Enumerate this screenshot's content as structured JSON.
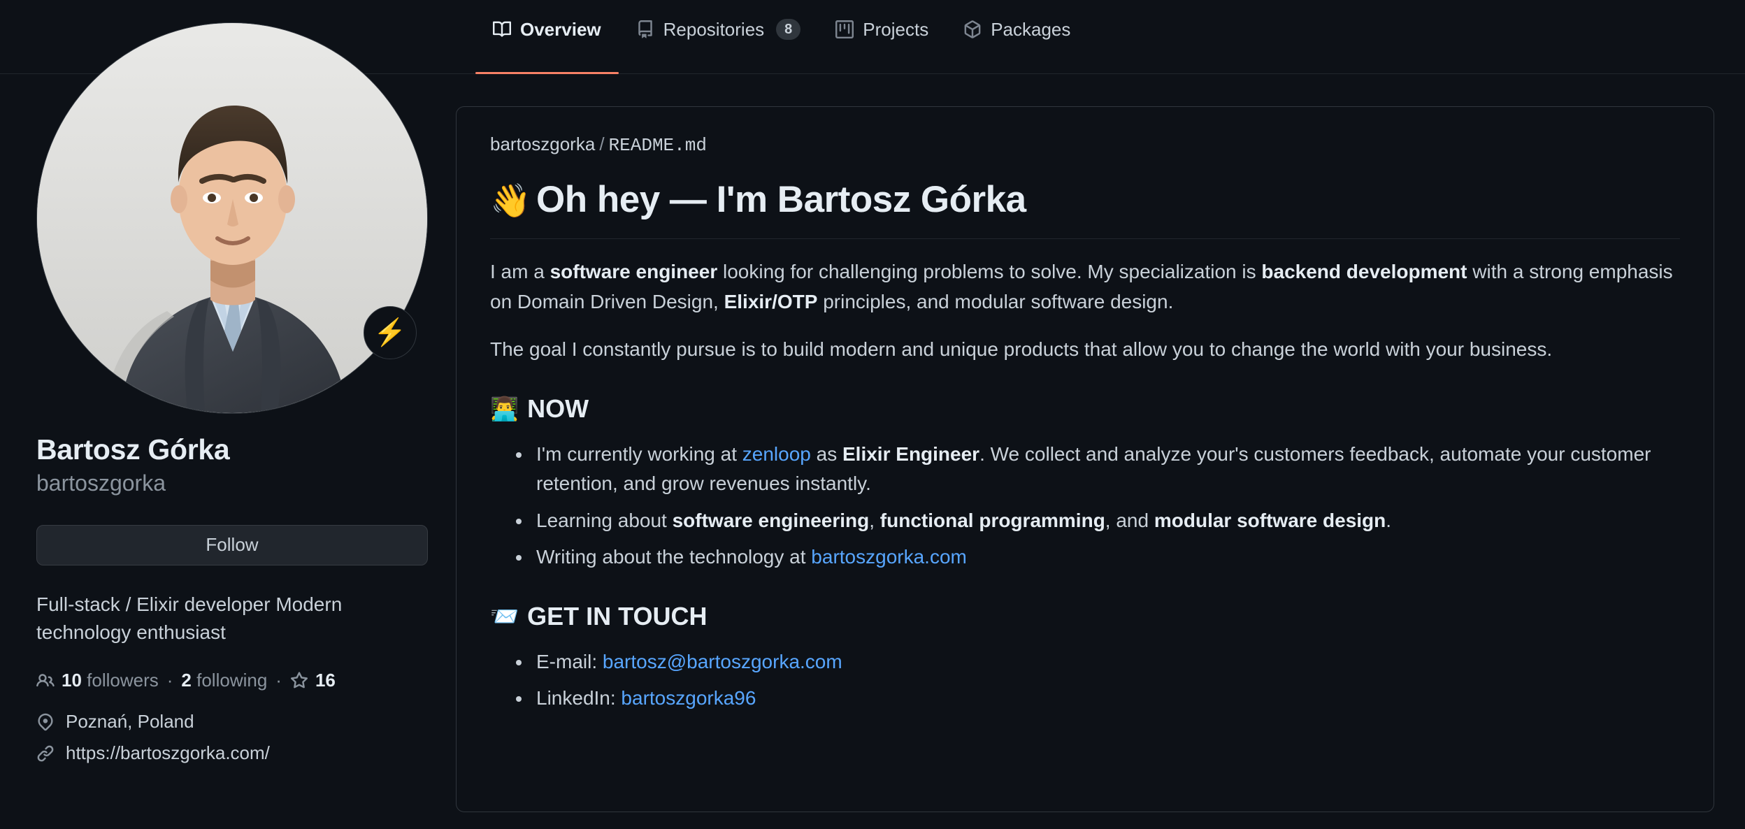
{
  "nav": {
    "tabs": [
      {
        "label": "Overview",
        "icon": "book-icon",
        "active": true,
        "count": null
      },
      {
        "label": "Repositories",
        "icon": "repo-icon",
        "active": false,
        "count": "8"
      },
      {
        "label": "Projects",
        "icon": "project-icon",
        "active": false,
        "count": null
      },
      {
        "label": "Packages",
        "icon": "package-icon",
        "active": false,
        "count": null
      }
    ]
  },
  "profile": {
    "status_emoji": "⚡",
    "full_name": "Bartosz Górka",
    "username": "bartoszgorka",
    "follow_label": "Follow",
    "bio": "Full-stack / Elixir developer Modern technology enthusiast",
    "stats": {
      "followers_count": "10",
      "followers_label": "followers",
      "separator": "·",
      "following_count": "2",
      "following_label": "following",
      "stars_count": "16"
    },
    "location": "Poznań, Poland",
    "website": "https://bartoszgorka.com/"
  },
  "readme": {
    "path_owner": "bartoszgorka",
    "path_separator": "/",
    "path_file": "README.md",
    "title_emoji": "👋",
    "title": "Oh hey — I'm Bartosz Górka",
    "p1": {
      "t1": "I am a ",
      "b1": "software engineer",
      "t2": " looking for challenging problems to solve. My specialization is ",
      "b2": "backend development",
      "t3": " with a strong emphasis on Domain Driven Design, ",
      "b3": "Elixir/OTP",
      "t4": " principles, and modular software design."
    },
    "p2": "The goal I constantly pursue is to build modern and unique products that allow you to change the world with your business.",
    "now": {
      "emoji": "👨‍💻",
      "heading": "NOW",
      "items": {
        "i1_t1": "I'm currently working at ",
        "i1_link": "zenloop",
        "i1_t2": " as ",
        "i1_b1": "Elixir Engineer",
        "i1_t3": ". We collect and analyze your's customers feedback, automate your customer retention, and grow revenues instantly.",
        "i2_t1": "Learning about ",
        "i2_b1": "software engineering",
        "i2_t2": ", ",
        "i2_b2": "functional programming",
        "i2_t3": ", and ",
        "i2_b3": "modular software design",
        "i2_t4": ".",
        "i3_t1": "Writing about the technology at ",
        "i3_link": "bartoszgorka.com"
      }
    },
    "touch": {
      "emoji": "📨",
      "heading": "GET IN TOUCH",
      "email_label": "E-mail: ",
      "email_link": "bartosz@bartoszgorka.com",
      "linkedin_label": "LinkedIn: ",
      "linkedin_link": "bartoszgorka96"
    }
  },
  "colors": {
    "accent_link": "#58a6ff",
    "active_tab_underline": "#f78166",
    "background": "#0d1117",
    "border": "#30363d"
  }
}
